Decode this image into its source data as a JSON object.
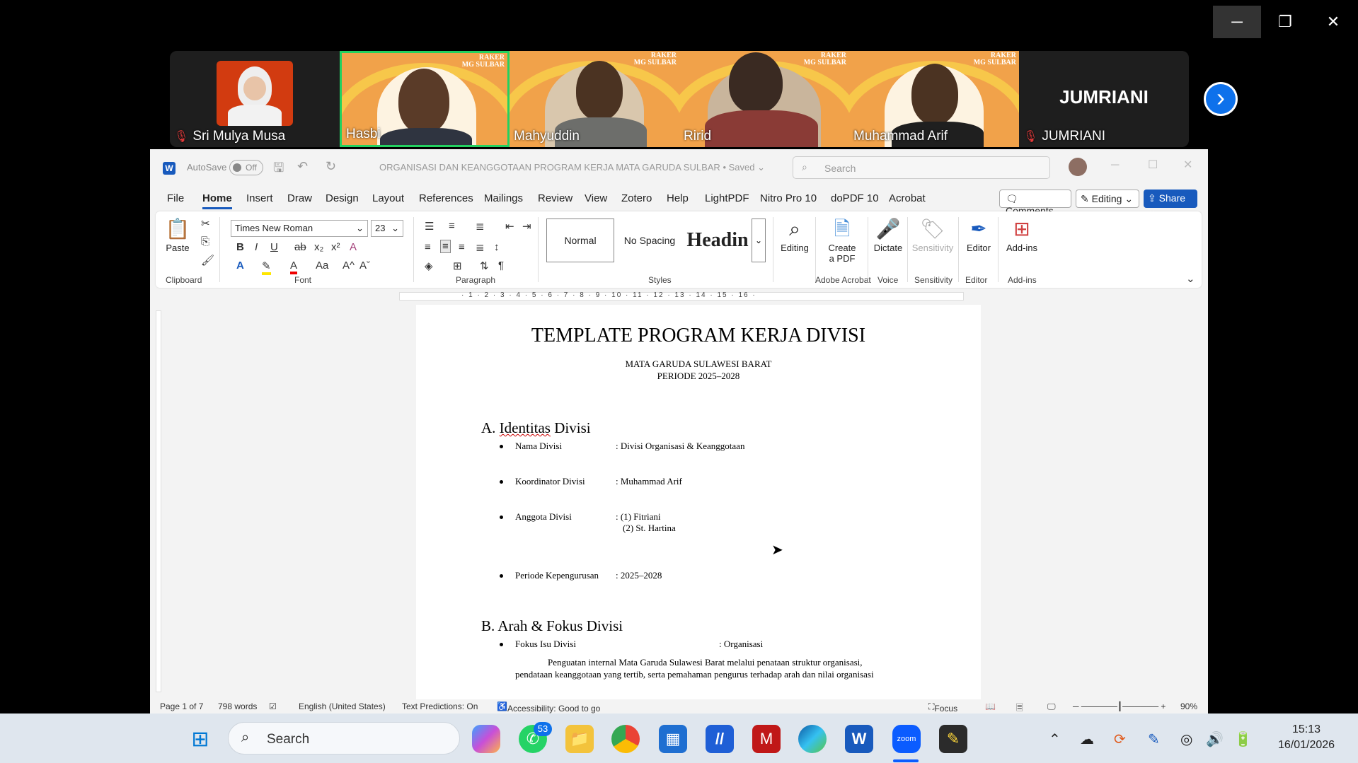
{
  "zoom_window": {
    "minimize": "─",
    "restore": "❐",
    "close": "✕"
  },
  "participants": [
    {
      "name": "Sri Mulya Musa",
      "muted": true
    },
    {
      "name": "Hasbi",
      "muted": false
    },
    {
      "name": "Mahyuddin",
      "muted": false
    },
    {
      "name": "Ririd",
      "muted": false
    },
    {
      "name": "Muhammad Arif",
      "muted": false
    },
    {
      "name": "JUMRIANI",
      "muted": true,
      "display_name": "JUMRIANI"
    }
  ],
  "raker_badge": "RAKER\nMG SULBAR",
  "next_arrow": "›",
  "word": {
    "autosave_label": "AutoSave",
    "autosave_state": "Off",
    "doc_title": "ORGANISASI DAN KEANGGOTAAN PROGRAM KERJA MATA GARUDA SULBAR",
    "saved_state": "• Saved",
    "search_placeholder": "Search",
    "menus": [
      "File",
      "Home",
      "Insert",
      "Draw",
      "Design",
      "Layout",
      "References",
      "Mailings",
      "Review",
      "View",
      "Zotero",
      "Help",
      "LightPDF",
      "Nitro Pro 10",
      "doPDF 10",
      "Acrobat"
    ],
    "comments_label": "Comments",
    "editing_label": "Editing",
    "share_label": "Share",
    "ribbon": {
      "paste": "Paste",
      "font_name": "Times New Roman",
      "font_size": "23",
      "styles": [
        "Normal",
        "No Spacing",
        "Headin"
      ],
      "editing": "Editing",
      "create_pdf_1": "Create",
      "create_pdf_2": "a PDF",
      "dictate": "Dictate",
      "sensitivity": "Sensitivity",
      "editor": "Editor",
      "addins": "Add-ins",
      "groups": [
        "Clipboard",
        "Font",
        "Paragraph",
        "Styles",
        "Adobe Acrobat",
        "Voice",
        "Sensitivity",
        "Editor",
        "Add-ins"
      ]
    },
    "ruler_nums": "· 1 · 2 · 3 · 4 · 5 · 6 · 7 · 8 · 9 · 10 · 11 · 12 · 13 · 14 · 15 · 16 ·",
    "doc": {
      "title": "TEMPLATE PROGRAM KERJA DIVISI",
      "sub1": "MATA GARUDA SULAWESI BARAT",
      "sub2": "PERIODE 2025–2028",
      "secA": "A. Identitas Divisi",
      "secA_num": "A. ",
      "secA_text": "Identitas",
      "secA_tail": " Divisi",
      "items": [
        {
          "label": "Nama Divisi",
          "value": ": Divisi Organisasi & Keanggotaan"
        },
        {
          "label": "Koordinator Divisi",
          "value": ": Muhammad Arif"
        },
        {
          "label": "Anggota Divisi",
          "value": ":  (1) Fitriani"
        },
        {
          "label": "",
          "value": "(2) St. Hartina"
        },
        {
          "label": "Periode Kepengurusan",
          "value": ": 2025–2028"
        }
      ],
      "secB": "B. Arah & Fokus Divisi",
      "fokus_label": "Fokus Isu Divisi",
      "fokus_value": ": Organisasi",
      "para1": "Penguatan internal Mata Garuda Sulawesi Barat melalui penataan struktur organisasi,",
      "para2": "pendataan keanggotaan yang tertib, serta pemahaman pengurus terhadap arah dan nilai organisasi"
    },
    "status": {
      "page": "Page 1 of 7",
      "words": "798 words",
      "language": "English (United States)",
      "predictions": "Text Predictions: On",
      "accessibility": "Accessibility: Good to go",
      "focus": "Focus",
      "zoom": "90%"
    }
  },
  "taskbar": {
    "search": "Search",
    "whatsapp_badge": "53",
    "time": "15:13",
    "date": "16/01/2026"
  }
}
